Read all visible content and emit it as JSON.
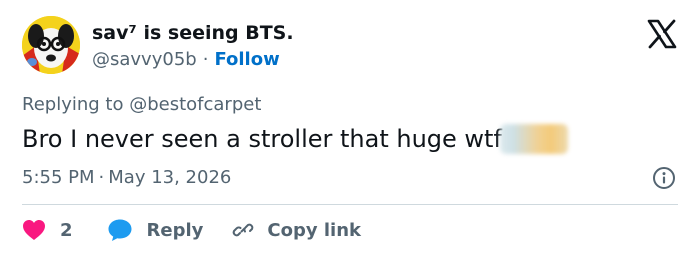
{
  "author": {
    "display_name": "sav⁷ is seeing BTS.",
    "handle": "@savvy05b",
    "separator": "·",
    "follow_label": "Follow"
  },
  "tweet": {
    "replying_to_prefix": "Replying to",
    "replying_to_handle": "@bestofcarpet",
    "text": "Bro I never seen a stroller that huge wtf",
    "time": "5:55 PM",
    "date_separator": "·",
    "date": "May 13, 2026"
  },
  "actions": {
    "like_count": "2",
    "reply_label": "Reply",
    "copy_link_label": "Copy link"
  },
  "colors": {
    "text": "#0f1419",
    "muted": "#536471",
    "link": "#0070c9",
    "like": "#f91880",
    "reply": "#1d9bf0",
    "divider": "#cfd9de"
  },
  "icons": {
    "logo": "x-logo-icon",
    "like": "heart-icon",
    "reply": "speech-bubble-icon",
    "copy_link": "link-icon",
    "info": "info-icon"
  }
}
